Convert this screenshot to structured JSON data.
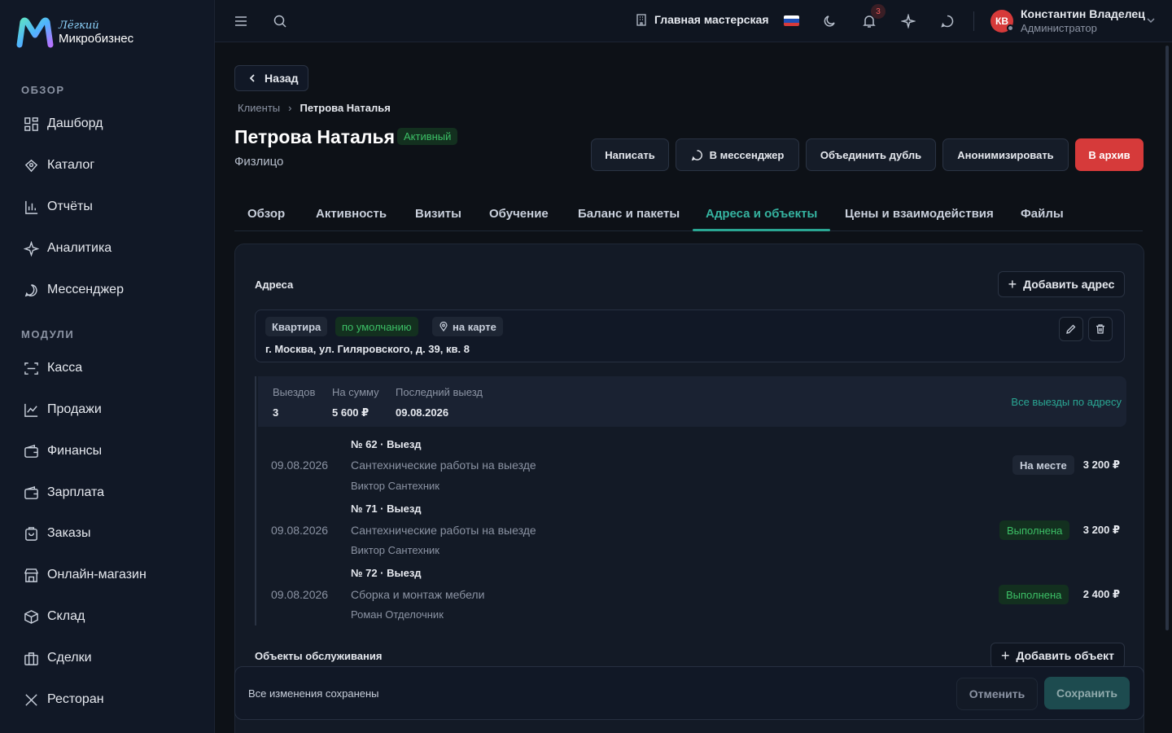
{
  "brand": {
    "light": "Лёгкий",
    "name": "Микробизнес"
  },
  "sidebar": {
    "section_overview": "ОБЗОР",
    "section_modules": "МОДУЛИ",
    "overview_items": [
      {
        "label": "Дашборд",
        "icon": "dashboard-icon"
      },
      {
        "label": "Каталог",
        "icon": "catalog-icon"
      },
      {
        "label": "Отчёты",
        "icon": "reports-icon"
      },
      {
        "label": "Аналитика",
        "icon": "analytics-icon"
      },
      {
        "label": "Мессенджер",
        "icon": "messenger-icon"
      }
    ],
    "module_items": [
      {
        "label": "Касса",
        "icon": "cashbox-icon"
      },
      {
        "label": "Продажи",
        "icon": "sales-icon"
      },
      {
        "label": "Финансы",
        "icon": "finance-icon"
      },
      {
        "label": "Зарплата",
        "icon": "payroll-icon"
      },
      {
        "label": "Заказы",
        "icon": "orders-icon"
      },
      {
        "label": "Онлайн-магазин",
        "icon": "shop-icon"
      },
      {
        "label": "Склад",
        "icon": "warehouse-icon"
      },
      {
        "label": "Сделки",
        "icon": "deals-icon"
      },
      {
        "label": "Ресторан",
        "icon": "restaurant-icon"
      }
    ]
  },
  "topbar": {
    "workshop": "Главная мастерская",
    "notifications_count": "3",
    "user": {
      "initials": "КВ",
      "name": "Константин Владелец",
      "role": "Администратор"
    }
  },
  "page": {
    "back": "Назад",
    "breadcrumb": [
      "Клиенты",
      "Петрова Наталья"
    ],
    "title": "Петрова Наталья",
    "status": "Активный",
    "subtitle": "Физлицо",
    "actions": [
      "Написать",
      "В мессенджер",
      "Объединить дубль",
      "Анонимизировать",
      "В архив"
    ],
    "tabs": [
      "Обзор",
      "Активность",
      "Визиты",
      "Обучение",
      "Баланс и пакеты",
      "Адреса и объекты",
      "Цены и взаимодействия",
      "Файлы"
    ],
    "active_tab": "Адреса и объекты"
  },
  "addresses": {
    "title": "Адреса",
    "add_label": "Добавить адрес",
    "card": {
      "type": "Квартира",
      "default_chip": "по умолчанию",
      "map_chip": "на карте",
      "address": "г. Москва, ул. Гиляровского, д. 39, кв. 8"
    },
    "summary": {
      "trips_label": "Выездов",
      "trips_value": "3",
      "sum_label": "На сумму",
      "sum_value": "5 600 ₽",
      "last_label": "Последний выезд",
      "last_value": "09.08.2026",
      "all_link": "Все выезды по адресу"
    },
    "trips": [
      {
        "date": "09.08.2026",
        "title": "№ 62 · Выезд",
        "desc": "Сантехнические работы на выезде",
        "person": "Виктор Сантехник",
        "status": "На месте",
        "amount": "3 200 ₽"
      },
      {
        "date": "09.08.2026",
        "title": "№ 71 · Выезд",
        "desc": "Сантехнические работы на выезде",
        "person": "Виктор Сантехник",
        "status": "Выполнена",
        "amount": "3 200 ₽"
      },
      {
        "date": "09.08.2026",
        "title": "№ 72 · Выезд",
        "desc": "Сборка и монтаж мебели",
        "person": "Роман Отделочник",
        "status": "Выполнена",
        "amount": "2 400 ₽"
      }
    ]
  },
  "objects": {
    "title": "Объекты обслуживания",
    "add_label": "Добавить объект"
  },
  "savebar": {
    "status": "Все изменения сохранены",
    "cancel": "Отменить",
    "save": "Сохранить"
  },
  "colors": {
    "accent": "#2aa693",
    "danger": "#d63a3a",
    "success": "#3cbf66"
  }
}
